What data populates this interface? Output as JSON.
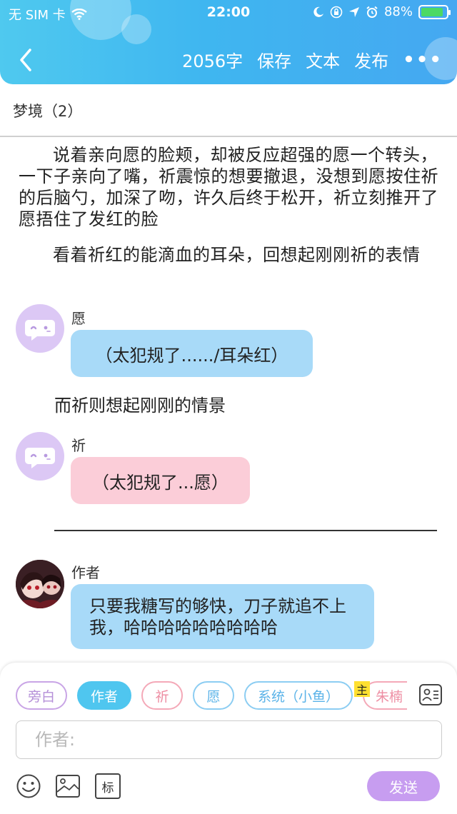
{
  "status_bar": {
    "carrier": "无 SIM 卡",
    "time": "22:00",
    "battery_text": "88%",
    "battery_level": 0.88,
    "battery_color": "#4cd964"
  },
  "header": {
    "word_count": "2056字",
    "save_label": "保存",
    "text_label": "文本",
    "publish_label": "发布",
    "more_label": "•••",
    "gradient": [
      "#4fc9ef",
      "#45a8f1"
    ]
  },
  "chapter": {
    "title": "梦境（2）"
  },
  "content": {
    "paragraph_1": "说着亲向愿的脸颊，却被反应超强的愿一个转头，一下子亲向了嘴，祈震惊的想要撤退，没想到愿按住祈的后脑勺，加深了吻，许久后终于松开，祈立刻推开了愿捂住了发红的脸",
    "paragraph_2": "看着祈红的能滴血的耳朵，回想起刚刚祈的表情",
    "msg_1": {
      "speaker": "愿",
      "text": "（太犯规了....../耳朵红）"
    },
    "narration_1": "而祈则想起刚刚的情景",
    "msg_2": {
      "speaker": "祈",
      "text": "（太犯规了...愿）"
    },
    "msg_3": {
      "speaker": "作者",
      "text": "只要我糖写的够快，刀子就追不上我，哈哈哈哈哈哈哈哈哈"
    }
  },
  "composer": {
    "roles": [
      "旁白",
      "作者",
      "祈",
      "愿",
      "系统（小鱼）",
      "朱楠"
    ],
    "selected_role": "作者",
    "main_badge": "主",
    "input_placeholder": "作者:",
    "input_value": "",
    "tag_label": "标",
    "send_label": "发送"
  }
}
